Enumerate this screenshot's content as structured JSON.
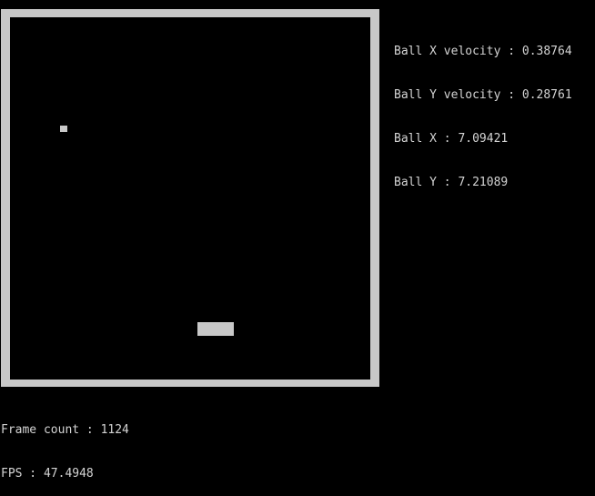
{
  "stats": {
    "ball_x_velocity": "Ball X velocity : 0.38764",
    "ball_y_velocity": "Ball Y velocity : 0.28761",
    "ball_x": "Ball X : 7.09421",
    "ball_y": "Ball Y : 7.21089"
  },
  "footer": {
    "frame_count": "Frame count : 1124",
    "fps": "FPS : 47.4948"
  },
  "colors": {
    "background": "#000000",
    "wall": "#c8c8c8",
    "text": "#d4d4d4"
  }
}
